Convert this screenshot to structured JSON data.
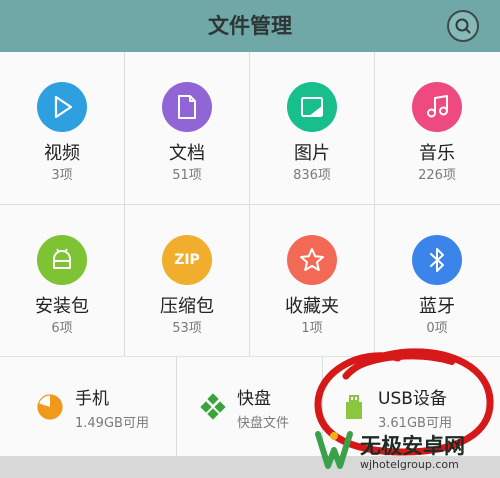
{
  "header": {
    "title": "文件管理",
    "search_icon": "search-icon"
  },
  "categories": [
    {
      "label": "视频",
      "count": "3项",
      "icon": "play-icon",
      "color": "#2ea0e0"
    },
    {
      "label": "文档",
      "count": "51项",
      "icon": "document-icon",
      "color": "#9165d6"
    },
    {
      "label": "图片",
      "count": "836项",
      "icon": "image-icon",
      "color": "#18bf8c"
    },
    {
      "label": "音乐",
      "count": "226项",
      "icon": "music-note-icon",
      "color": "#ee4a7f"
    },
    {
      "label": "安装包",
      "count": "6项",
      "icon": "android-package-icon",
      "color": "#7dc334"
    },
    {
      "label": "压缩包",
      "count": "53项",
      "icon": "zip-icon",
      "icon_text": "ZIP",
      "color": "#f1ae2d"
    },
    {
      "label": "收藏夹",
      "count": "1项",
      "icon": "star-icon",
      "color": "#f26a55"
    },
    {
      "label": "蓝牙",
      "count": "0项",
      "icon": "bluetooth-icon",
      "color": "#3a84ea"
    }
  ],
  "storage": [
    {
      "title": "手机",
      "subtitle": "1.49GB可用",
      "icon": "pie-storage-icon",
      "color": "#f2991c"
    },
    {
      "title": "快盘",
      "subtitle": "快盘文件",
      "icon": "kuaipan-icon",
      "color": "#3aa33a"
    },
    {
      "title": "USB设备",
      "subtitle": "3.61GB可用",
      "icon": "usb-drive-icon",
      "color": "#8bc63f"
    }
  ],
  "watermark": {
    "main": "无极安卓网",
    "url": "wjhotelgroup.com",
    "logo_color": "#3aa04a"
  },
  "annotation_color": "#d71818"
}
